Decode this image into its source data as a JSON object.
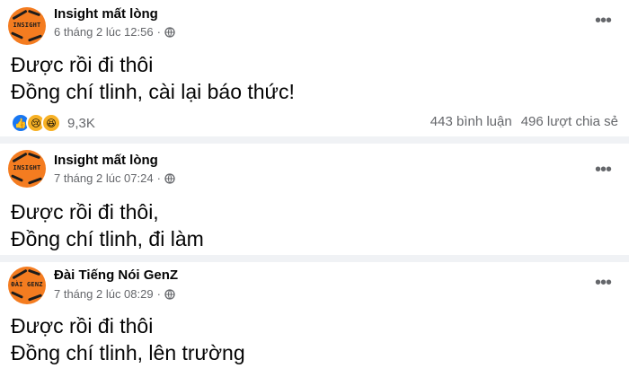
{
  "posts": [
    {
      "author": "Insight mất lòng",
      "avatar_text": "INSIGHT",
      "timestamp": "6 tháng 2 lúc 12:56",
      "lines": [
        "Được rồi đi thôi",
        "Đồng chí tlinh, cài lại báo thức!"
      ],
      "reaction_count": "9,3K",
      "comments": "443 bình luận",
      "shares": "496 lượt chia sẻ"
    },
    {
      "author": "Insight mất lòng",
      "avatar_text": "INSIGHT",
      "timestamp": "7 tháng 2 lúc 07:24",
      "lines": [
        "Được rồi đi thôi,",
        "Đồng chí tlinh, đi làm"
      ]
    },
    {
      "author": "Đài Tiếng Nói GenZ",
      "avatar_text": "ĐÀI GENZ",
      "timestamp": "7 tháng 2 lúc 08:29",
      "lines": [
        "Được rồi đi thôi",
        "Đồng chí tlinh, lên trường"
      ]
    }
  ],
  "icons": {
    "privacy": "globe-icon",
    "more": "more-options-icon",
    "reactions": [
      "like-icon",
      "sad-icon",
      "haha-icon"
    ]
  },
  "colors": {
    "avatar_bg": "#f47c20",
    "secondary_text": "#65676b",
    "like_blue": "#1877f2"
  }
}
